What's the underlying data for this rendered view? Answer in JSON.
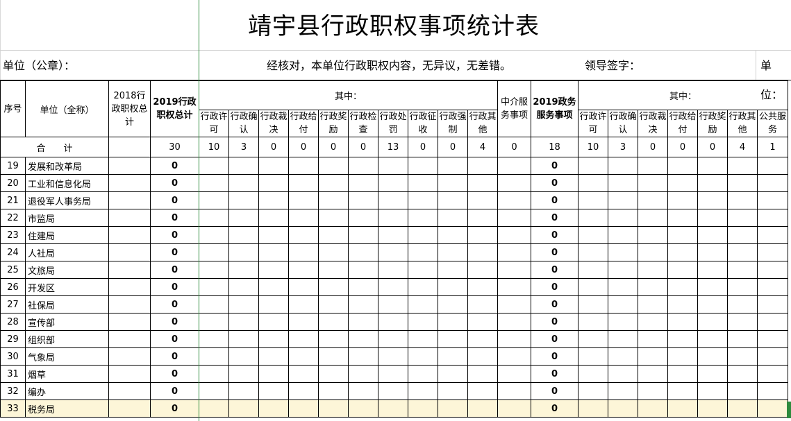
{
  "sheet": {
    "title": "靖宇县行政职权事项统计表",
    "unit_label": "单位（公章）：",
    "confirm_note": "经核对，本单位行政职权内容，无异议，无差错。",
    "leader_sign": "领导签字：",
    "unit_short": "单位："
  },
  "table": {
    "headers": {
      "seq": "序号",
      "unit": "单位（全称）",
      "total2018": "2018行政职权总计",
      "total2019": "2019行政职权总计",
      "among1": "其中：",
      "intermediary": "中介服务事项",
      "gov2019": "2019政务服务事项",
      "among2": "其中：",
      "sub1": [
        "行政许可",
        "行政确认",
        "行政裁决",
        "行政给付",
        "行政奖励",
        "行政检查",
        "行政处罚",
        "行政征收",
        "行政强制",
        "行政其他"
      ],
      "sub2": [
        "行政许可",
        "行政确认",
        "行政裁决",
        "行政给付",
        "行政奖励",
        "行政其他",
        "公共服务"
      ]
    },
    "summary": {
      "label": "合　　计",
      "total2018": "",
      "total2019": "30",
      "breakdown1": [
        "10",
        "3",
        "0",
        "0",
        "0",
        "0",
        "13",
        "0",
        "0",
        "4"
      ],
      "intermediary": "0",
      "gov2019": "18",
      "breakdown2": [
        "10",
        "3",
        "0",
        "0",
        "0",
        "4",
        "1"
      ]
    },
    "rows": [
      {
        "seq": "19",
        "unit": "发展和改革局",
        "total2019": "0",
        "gov2019": "0"
      },
      {
        "seq": "20",
        "unit": "工业和信息化局",
        "total2019": "0",
        "gov2019": "0"
      },
      {
        "seq": "21",
        "unit": "退役军人事务局",
        "total2019": "0",
        "gov2019": "0"
      },
      {
        "seq": "22",
        "unit": "市监局",
        "total2019": "0",
        "gov2019": "0"
      },
      {
        "seq": "23",
        "unit": "住建局",
        "total2019": "0",
        "gov2019": "0"
      },
      {
        "seq": "24",
        "unit": "人社局",
        "total2019": "0",
        "gov2019": "0"
      },
      {
        "seq": "25",
        "unit": "文旅局",
        "total2019": "0",
        "gov2019": "0"
      },
      {
        "seq": "26",
        "unit": "开发区",
        "total2019": "0",
        "gov2019": "0"
      },
      {
        "seq": "27",
        "unit": "社保局",
        "total2019": "0",
        "gov2019": "0"
      },
      {
        "seq": "28",
        "unit": "宣传部",
        "total2019": "0",
        "gov2019": "0"
      },
      {
        "seq": "29",
        "unit": "组织部",
        "total2019": "0",
        "gov2019": "0"
      },
      {
        "seq": "30",
        "unit": "气象局",
        "total2019": "0",
        "gov2019": "0"
      },
      {
        "seq": "31",
        "unit": "烟草",
        "total2019": "0",
        "gov2019": "0"
      },
      {
        "seq": "32",
        "unit": "编办",
        "total2019": "0",
        "gov2019": "0"
      },
      {
        "seq": "33",
        "unit": "税务局",
        "total2019": "0",
        "gov2019": "0"
      }
    ]
  }
}
